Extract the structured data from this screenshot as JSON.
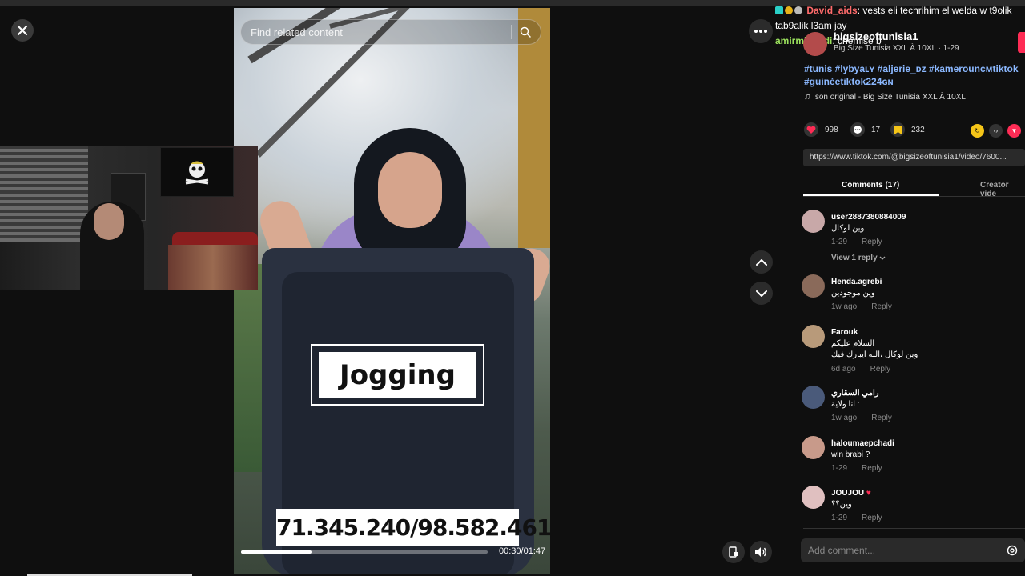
{
  "video": {
    "search_placeholder": "Find related content",
    "overlay_label": "Jogging",
    "phone_numbers": "71.345.240/98.582.461",
    "timecode": "00:30/01:47",
    "progress_fraction": 0.285
  },
  "chat": {
    "line1_user": "David_aids",
    "line1_text": ": vests eli techrihim el welda w t9olik tab9alik l3am jay",
    "line2_user": "amirmhamdi",
    "line2_text": ": chemise b"
  },
  "creator": {
    "handle": "bigsizeoftunisia1",
    "subtitle": "Big Size Tunisia XXL À 10XL · 1-29",
    "hashtags": "#tunis #lybyaʟʏ #aljerie_ᴅᴢ #kamerounᴄᴍtiktok #guinéetiktok224ɢɴ",
    "music": "son original - Big Size Tunisia XXL À 10XL"
  },
  "stats": {
    "likes": "998",
    "comments": "17",
    "saves": "232"
  },
  "link": "https://www.tiktok.com/@bigsizeoftunisia1/video/7600...",
  "tabs": {
    "comments": "Comments (17)",
    "creator_videos": "Creator vide"
  },
  "comments": [
    {
      "name": "user2887380884009",
      "text": "وين لوكال",
      "text2": "",
      "date": "1-29",
      "reply": "Reply",
      "view_replies": "View 1 reply",
      "avatar_color": "#c8a8a8"
    },
    {
      "name": "Henda.agrebi",
      "text": "وين موجودين",
      "text2": "",
      "date": "1w ago",
      "reply": "Reply",
      "view_replies": "",
      "avatar_color": "#8a6a5a"
    },
    {
      "name": "Farouk",
      "text": "السلام عليكم",
      "text2": "وين لوكال ،الله ايبارك فيك",
      "date": "6d ago",
      "reply": "Reply",
      "view_replies": "",
      "avatar_color": "#b89a7a"
    },
    {
      "name": "رامي السقاري",
      "text": "انا ولاية :",
      "text2": "",
      "date": "1w ago",
      "reply": "Reply",
      "view_replies": "",
      "avatar_color": "#4a5a7a"
    },
    {
      "name": "haloumaepchadi",
      "text": "win brabi ?",
      "text2": "",
      "date": "1-29",
      "reply": "Reply",
      "view_replies": "",
      "avatar_color": "#c89a8a"
    },
    {
      "name": "JOUJOU",
      "text": "وين؟؟",
      "text2": "",
      "date": "1-29",
      "reply": "Reply",
      "view_replies": "",
      "avatar_color": "#e0c0c0"
    }
  ],
  "add_comment_placeholder": "Add comment...",
  "colors": {
    "accent": "#fe2c55",
    "hashtag": "#8bb8ff",
    "background": "#0f0f0f"
  }
}
